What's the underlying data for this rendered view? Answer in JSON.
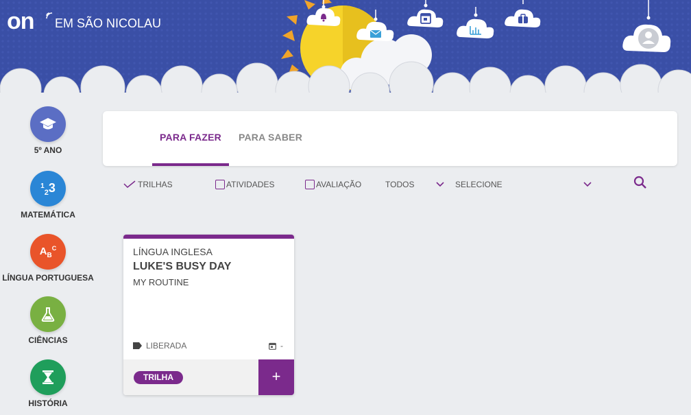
{
  "header": {
    "logo": "on",
    "school": "EM SÃO NICOLAU",
    "icons": [
      "bell-icon",
      "mail-icon",
      "calendar-icon",
      "chart-icon",
      "backpack-icon",
      "user-avatar-icon"
    ]
  },
  "sidebar": {
    "items": [
      {
        "label": "5º ANO",
        "icon": "graduation-cap-icon",
        "color": "#5b6ec4"
      },
      {
        "label": "MATEMÁTICA",
        "icon": "123-icon",
        "glyph": "123",
        "color": "#2a86d6"
      },
      {
        "label": "LÍNGUA PORTUGUESA",
        "icon": "abc-icon",
        "glyph": "ABC",
        "color": "#e9542a"
      },
      {
        "label": "CIÊNCIAS",
        "icon": "flask-icon",
        "color": "#79b042"
      },
      {
        "label": "HISTÓRIA",
        "icon": "hourglass-icon",
        "color": "#1f9e5b"
      }
    ]
  },
  "tabs": {
    "active": "PARA FAZER",
    "inactive": "PARA SABER"
  },
  "filters": {
    "trilhas": "TRILHAS",
    "atividades": "ATIVIDADES",
    "avaliacao": "AVALIAÇÃO",
    "todos": "TODOS",
    "selecione": "SELECIONE"
  },
  "card": {
    "subject": "LÍNGUA INGLESA",
    "title": "LUKE'S BUSY DAY",
    "subtitle": "MY ROUTINE",
    "status": "LIBERADA",
    "date": "-",
    "badge": "TRILHA",
    "add": "+"
  },
  "colors": {
    "accent": "#7b2a8c",
    "sky": "#3b4fa8",
    "sun": "#f6d32a"
  }
}
